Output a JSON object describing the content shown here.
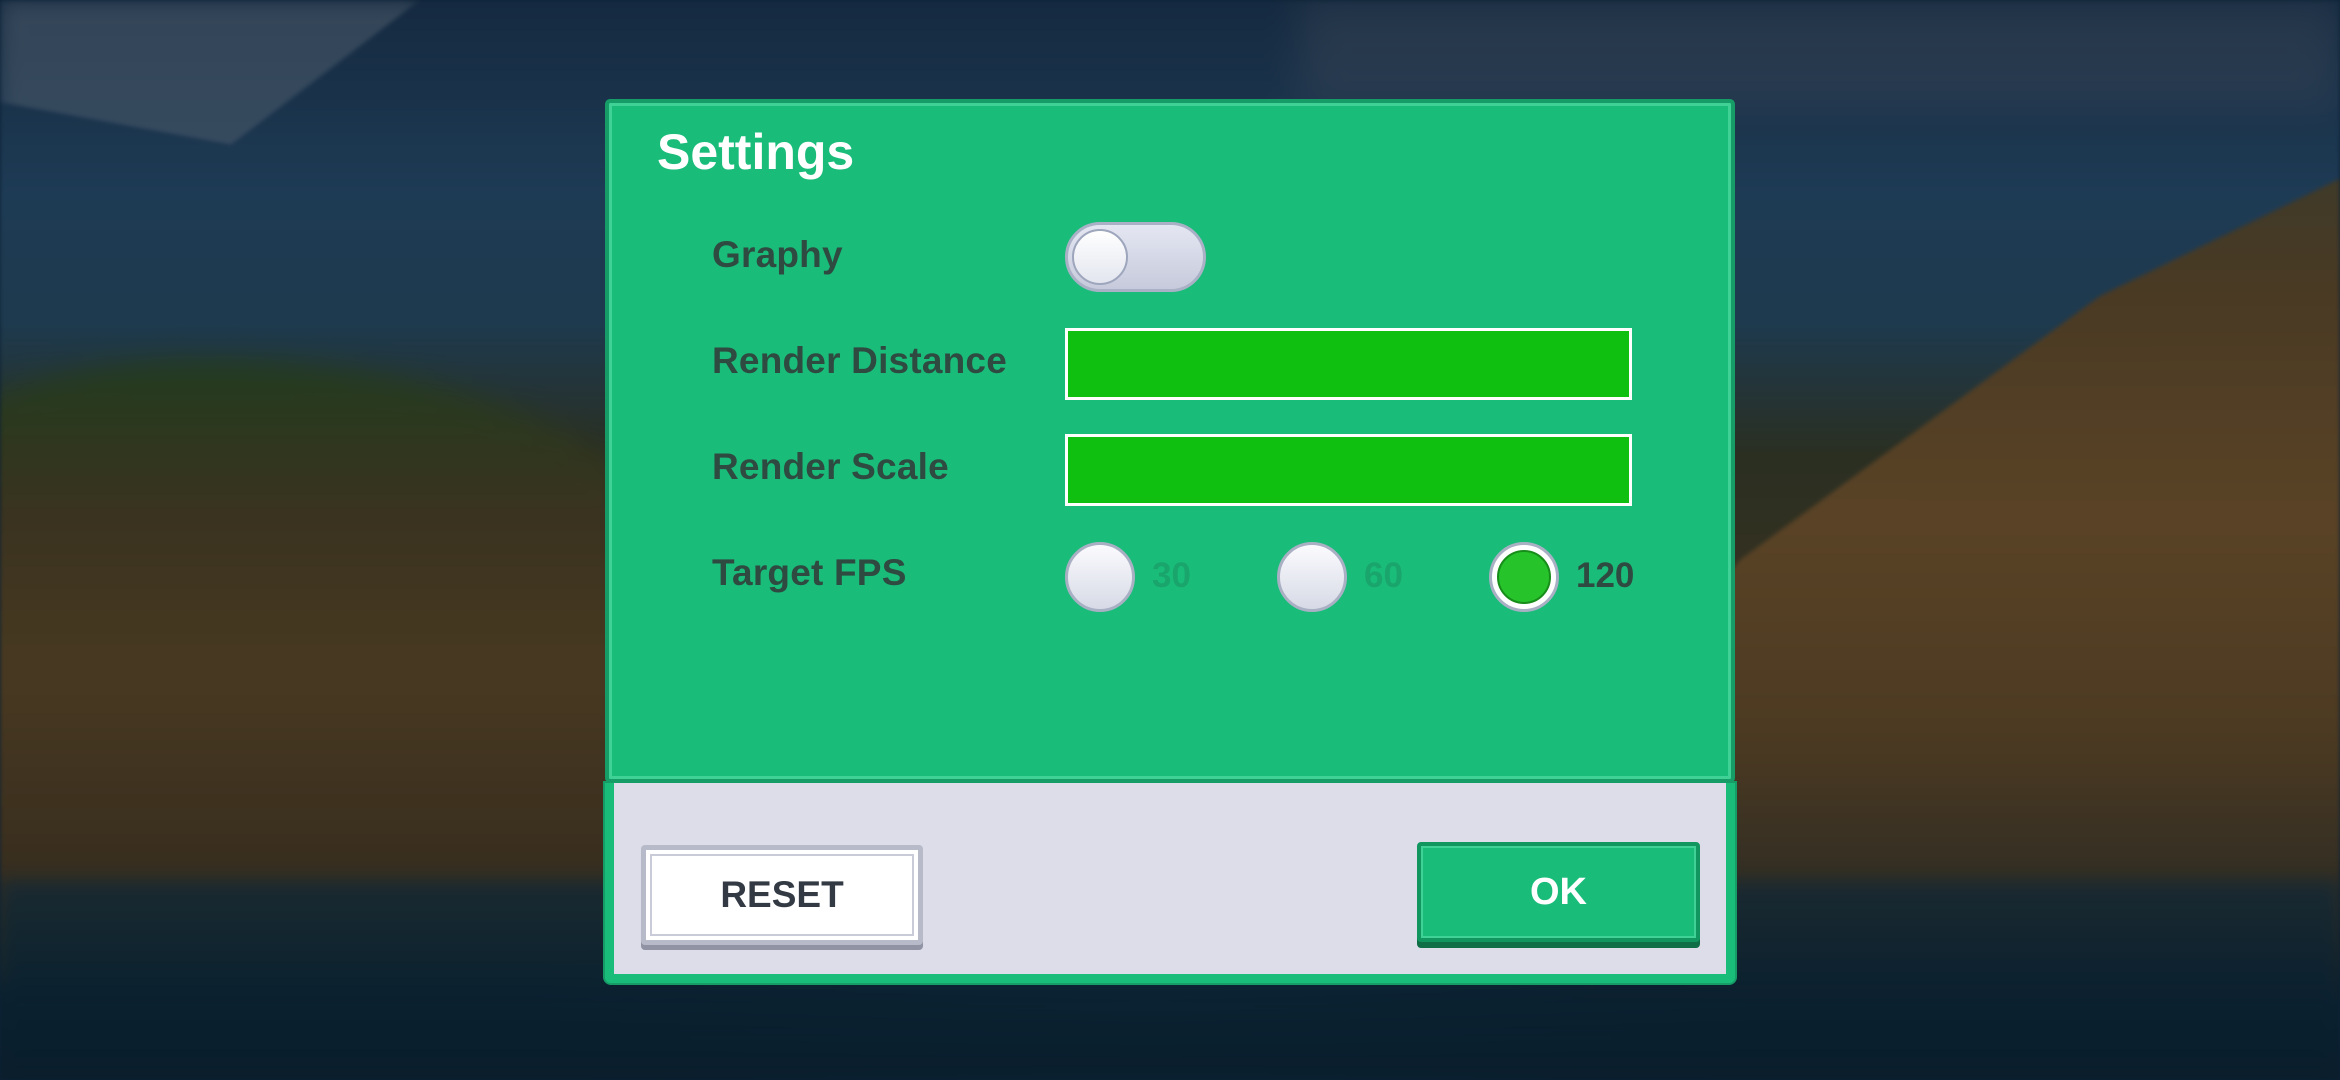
{
  "dialog": {
    "title": "Settings",
    "graphy": {
      "label": "Graphy",
      "enabled": false
    },
    "render_distance": {
      "label": "Render Distance",
      "value_fraction": 1.0
    },
    "render_scale": {
      "label": "Render Scale",
      "value_fraction": 1.0
    },
    "target_fps": {
      "label": "Target FPS",
      "options": [
        "30",
        "60",
        "120"
      ],
      "selected": "120"
    },
    "buttons": {
      "reset": "RESET",
      "ok": "OK"
    }
  },
  "colors": {
    "panel": "#1abc7a",
    "slider_fill": "#10c010",
    "radio_selected": "#26c32a",
    "footer": "#dcdde9"
  }
}
